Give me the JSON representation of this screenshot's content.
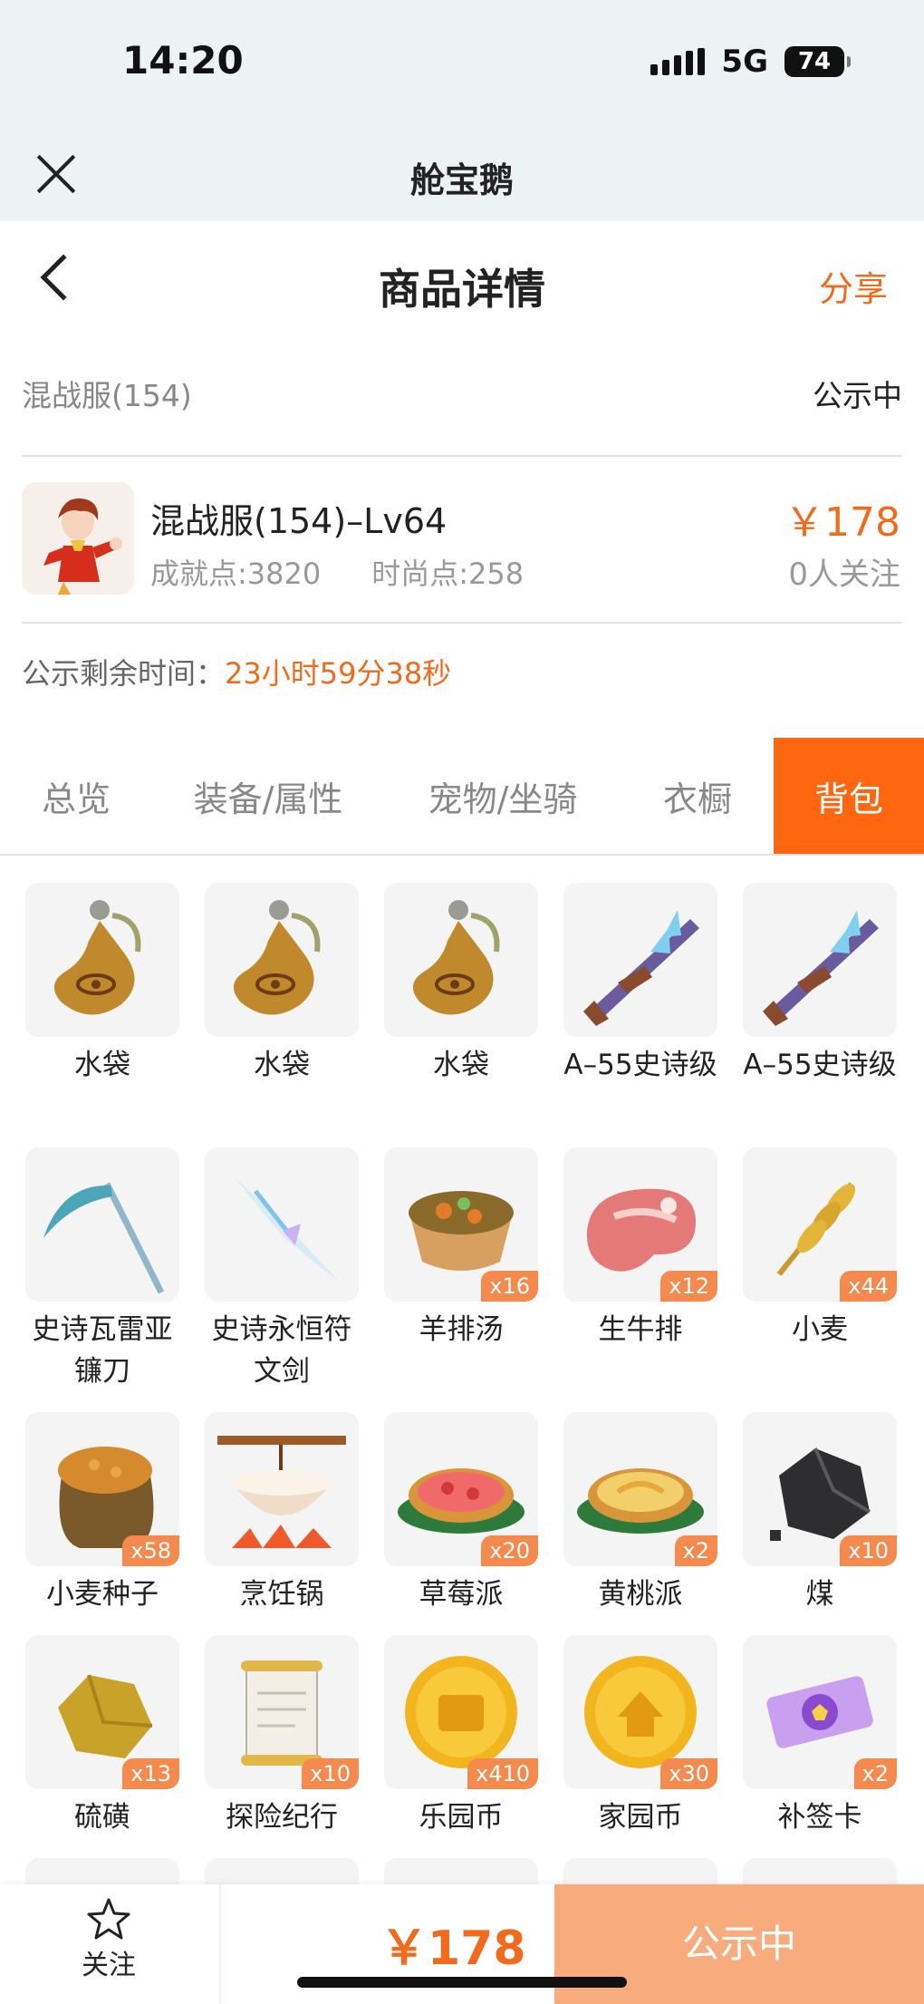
{
  "status_bar": {
    "time": "14:20",
    "network": "5G",
    "battery": "74"
  },
  "mini_app": {
    "title": "舱宝鹅"
  },
  "header": {
    "title": "商品详情",
    "share": "分享"
  },
  "server": {
    "name": "混战服(154)",
    "status": "公示中"
  },
  "product": {
    "name": "混战服(154)–Lv64",
    "achievement": "成就点:3820",
    "fashion": "时尚点:258",
    "price": "￥178",
    "followers": "0人关注"
  },
  "remaining": {
    "label": "公示剩余时间：",
    "value": "23小时59分38秒"
  },
  "tabs": [
    {
      "label": "总览",
      "active": false
    },
    {
      "label": "装备/属性",
      "active": false
    },
    {
      "label": "宠物/坐骑",
      "active": false
    },
    {
      "label": "衣橱",
      "active": false
    },
    {
      "label": "背包",
      "active": true
    }
  ],
  "items": [
    {
      "name": "水袋",
      "count": "",
      "icon": "water-bag-icon"
    },
    {
      "name": "水袋",
      "count": "",
      "icon": "water-bag-icon"
    },
    {
      "name": "水袋",
      "count": "",
      "icon": "water-bag-icon"
    },
    {
      "name": "A–55史诗级",
      "count": "",
      "icon": "rifle-icon"
    },
    {
      "name": "A–55史诗级",
      "count": "",
      "icon": "rifle-icon"
    },
    {
      "name": "史诗瓦雷亚镰刀",
      "count": "",
      "icon": "scythe-icon"
    },
    {
      "name": "史诗永恒符文剑",
      "count": "",
      "icon": "crystal-sword-icon"
    },
    {
      "name": "羊排汤",
      "count": "x16",
      "icon": "soup-icon"
    },
    {
      "name": "生牛排",
      "count": "x12",
      "icon": "steak-icon"
    },
    {
      "name": "小麦",
      "count": "x44",
      "icon": "wheat-icon"
    },
    {
      "name": "小麦种子",
      "count": "x58",
      "icon": "seed-sack-icon"
    },
    {
      "name": "烹饪锅",
      "count": "",
      "icon": "cooking-pot-icon"
    },
    {
      "name": "草莓派",
      "count": "x20",
      "icon": "strawberry-pie-icon"
    },
    {
      "name": "黄桃派",
      "count": "x2",
      "icon": "peach-pie-icon"
    },
    {
      "name": "煤",
      "count": "x10",
      "icon": "coal-icon"
    },
    {
      "name": "硫磺",
      "count": "x13",
      "icon": "sulfur-icon"
    },
    {
      "name": "探险纪行",
      "count": "x10",
      "icon": "scroll-icon"
    },
    {
      "name": "乐园币",
      "count": "x410",
      "icon": "park-coin-icon"
    },
    {
      "name": "家园币",
      "count": "x30",
      "icon": "home-coin-icon"
    },
    {
      "name": "补签卡",
      "count": "x2",
      "icon": "makeup-card-icon"
    },
    {
      "name": "",
      "count": "",
      "icon": "partial-item-icon"
    },
    {
      "name": "",
      "count": "",
      "icon": "partial-item-icon"
    },
    {
      "name": "",
      "count": "",
      "icon": "partial-item-icon"
    },
    {
      "name": "",
      "count": "",
      "icon": "partial-item-icon"
    },
    {
      "name": "",
      "count": "",
      "icon": "partial-item-icon"
    }
  ],
  "bottom_bar": {
    "follow_label": "关注",
    "price": "￥178",
    "status_button": "公示中"
  },
  "colors": {
    "accent": "#ff6610",
    "price": "#f26a1b",
    "status_button": "#f8ab7c",
    "badge": "#f48a4e"
  }
}
